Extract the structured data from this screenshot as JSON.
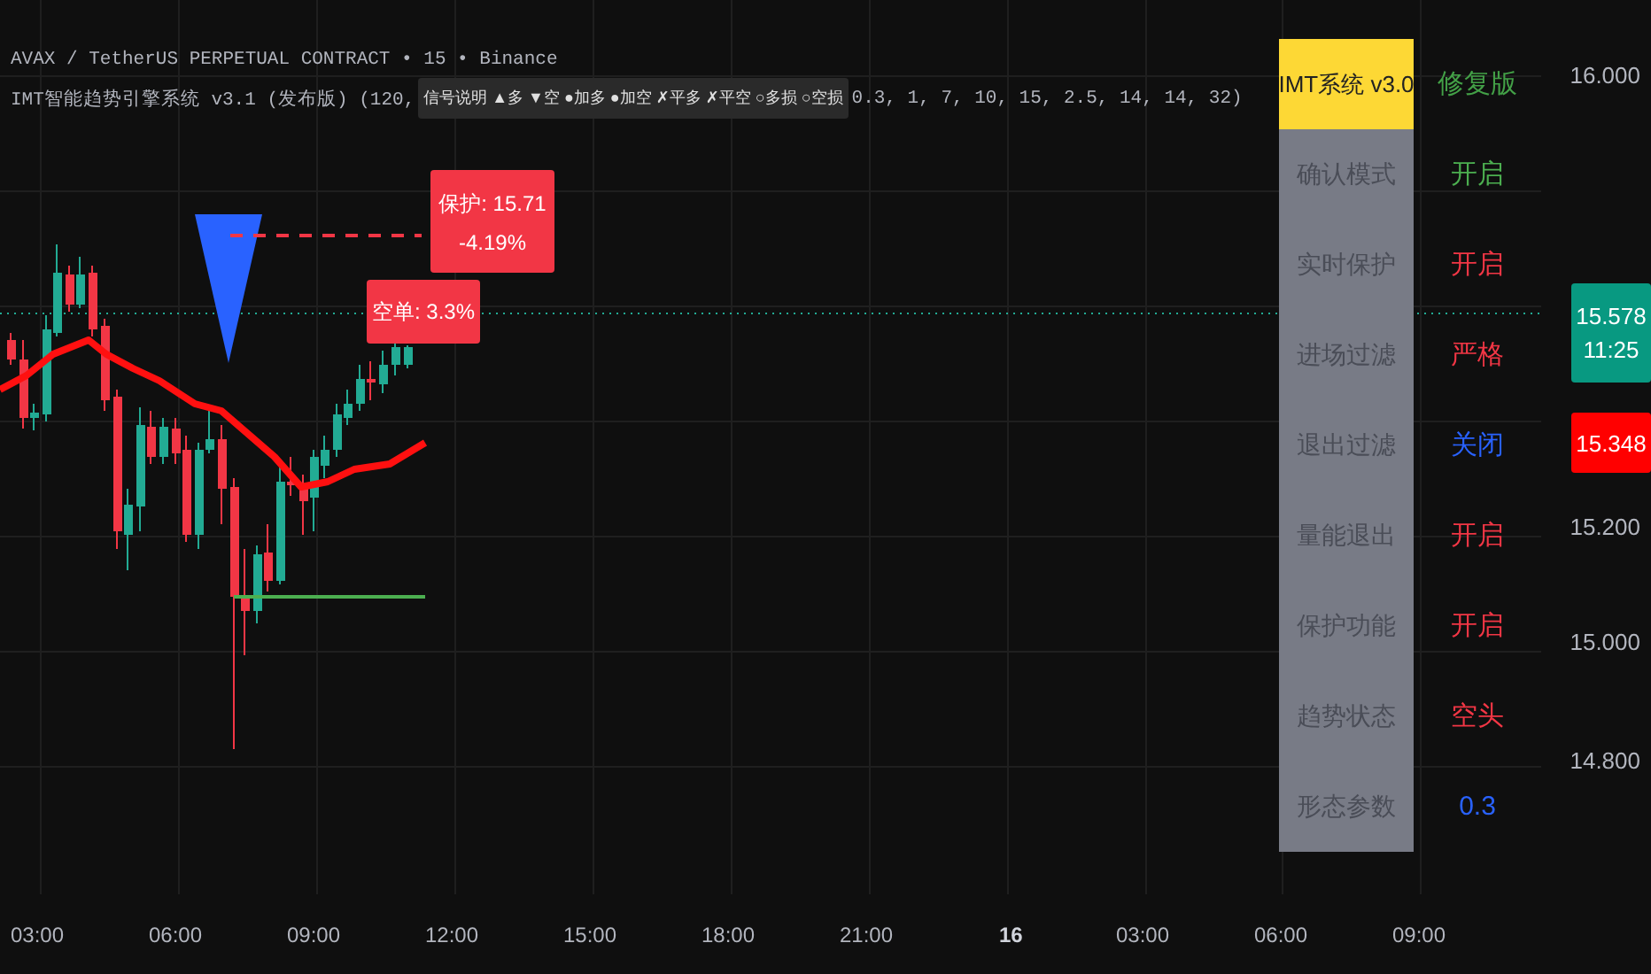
{
  "legend": {
    "symbol_line": "AVAX / TetherUS PERPETUAL CONTRACT • 15 • Binance",
    "indicator_name": "IMT智能趋势引擎系统 v3.1 (发布版) (120,",
    "tooltip": "信号说明 ▲多 ▼空 ●加多 ●加空 ✗平多 ✗平空 ○多损 ○空损",
    "indicator_params": "0.3, 1, 7, 10, 15, 2.5, 14, 14, 32)"
  },
  "chart": {
    "protect_label": {
      "title": "保护: 15.71",
      "change": "-4.19%"
    },
    "position_label": "空单: 3.3%"
  },
  "status_table": {
    "header": {
      "label": "IMT系统 v3.0",
      "value": "修复版",
      "color": "#43a047"
    },
    "rows": [
      {
        "label": "确认模式",
        "value": "开启",
        "color": "#4caf50"
      },
      {
        "label": "实时保护",
        "value": "开启",
        "color": "#f23645"
      },
      {
        "label": "进场过滤",
        "value": "严格",
        "color": "#f23645"
      },
      {
        "label": "退出过滤",
        "value": "关闭",
        "color": "#2962ff"
      },
      {
        "label": "量能退出",
        "value": "开启",
        "color": "#f23645"
      },
      {
        "label": "保护功能",
        "value": "开启",
        "color": "#f23645"
      },
      {
        "label": "趋势状态",
        "value": "空头",
        "color": "#f23645"
      },
      {
        "label": "形态参数",
        "value": "0.3",
        "color": "#2962ff"
      }
    ]
  },
  "price_axis": {
    "labels": [
      "16.000",
      "15.200",
      "15.000",
      "14.800"
    ],
    "last_price": {
      "price": "15.578",
      "countdown": "11:25"
    },
    "marker": "15.348"
  },
  "time_axis": {
    "labels": [
      {
        "text": "03:00",
        "bold": false
      },
      {
        "text": "06:00",
        "bold": false
      },
      {
        "text": "09:00",
        "bold": false
      },
      {
        "text": "12:00",
        "bold": false
      },
      {
        "text": "15:00",
        "bold": false
      },
      {
        "text": "18:00",
        "bold": false
      },
      {
        "text": "21:00",
        "bold": false
      },
      {
        "text": "16",
        "bold": true
      },
      {
        "text": "03:00",
        "bold": false
      },
      {
        "text": "06:00",
        "bold": false
      },
      {
        "text": "09:00",
        "bold": false
      }
    ]
  }
}
